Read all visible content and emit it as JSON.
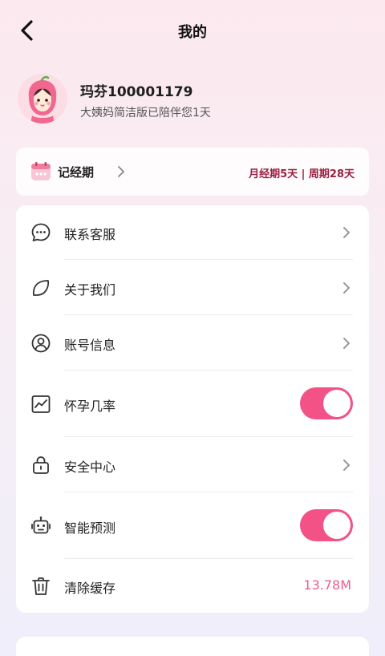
{
  "header": {
    "title": "我的"
  },
  "profile": {
    "username": "玛芬100001179",
    "subtitle": "大姨妈简洁版已陪伴您1天"
  },
  "period": {
    "label": "记经期",
    "summary": "月经期5天 | 周期28天"
  },
  "menu": {
    "items": [
      {
        "label": "联系客服",
        "icon": "chat-bubble-icon",
        "control": "chevron"
      },
      {
        "label": "关于我们",
        "icon": "leaf-icon",
        "control": "chevron"
      },
      {
        "label": "账号信息",
        "icon": "user-circle-icon",
        "control": "chevron"
      },
      {
        "label": "怀孕几率",
        "icon": "chart-trend-icon",
        "control": "toggle",
        "toggle_on": true
      },
      {
        "label": "安全中心",
        "icon": "lock-icon",
        "control": "chevron"
      },
      {
        "label": "智能预测",
        "icon": "robot-icon",
        "control": "toggle",
        "toggle_on": true
      },
      {
        "label": "清除缓存",
        "icon": "trash-icon",
        "control": "value",
        "value": "13.78M"
      }
    ]
  },
  "colors": {
    "accent": "#f25286",
    "period_text": "#9b1f3f",
    "cache_value": "#ee5d8b"
  }
}
